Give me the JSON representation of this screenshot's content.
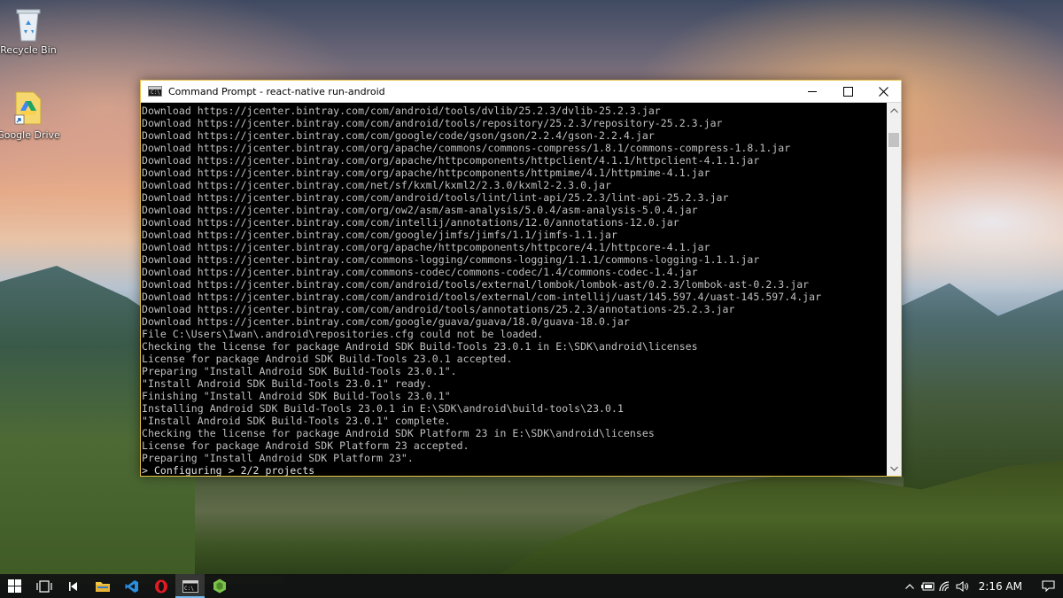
{
  "desktop": {
    "icons": [
      {
        "label": "Recycle Bin",
        "icon": "recycle-bin-icon"
      },
      {
        "label": "Google Drive",
        "icon": "google-drive-icon"
      }
    ]
  },
  "window": {
    "title": "Command Prompt - react-native  run-android",
    "controls": [
      "minimize",
      "maximize",
      "close"
    ],
    "border_color": "#e6c147"
  },
  "console": {
    "lines": [
      "Download https://jcenter.bintray.com/com/android/tools/dvlib/25.2.3/dvlib-25.2.3.jar",
      "Download https://jcenter.bintray.com/com/android/tools/repository/25.2.3/repository-25.2.3.jar",
      "Download https://jcenter.bintray.com/com/google/code/gson/gson/2.2.4/gson-2.2.4.jar",
      "Download https://jcenter.bintray.com/org/apache/commons/commons-compress/1.8.1/commons-compress-1.8.1.jar",
      "Download https://jcenter.bintray.com/org/apache/httpcomponents/httpclient/4.1.1/httpclient-4.1.1.jar",
      "Download https://jcenter.bintray.com/org/apache/httpcomponents/httpmime/4.1/httpmime-4.1.jar",
      "Download https://jcenter.bintray.com/net/sf/kxml/kxml2/2.3.0/kxml2-2.3.0.jar",
      "Download https://jcenter.bintray.com/com/android/tools/lint/lint-api/25.2.3/lint-api-25.2.3.jar",
      "Download https://jcenter.bintray.com/org/ow2/asm/asm-analysis/5.0.4/asm-analysis-5.0.4.jar",
      "Download https://jcenter.bintray.com/com/intellij/annotations/12.0/annotations-12.0.jar",
      "Download https://jcenter.bintray.com/com/google/jimfs/jimfs/1.1/jimfs-1.1.jar",
      "Download https://jcenter.bintray.com/org/apache/httpcomponents/httpcore/4.1/httpcore-4.1.jar",
      "Download https://jcenter.bintray.com/commons-logging/commons-logging/1.1.1/commons-logging-1.1.1.jar",
      "Download https://jcenter.bintray.com/commons-codec/commons-codec/1.4/commons-codec-1.4.jar",
      "Download https://jcenter.bintray.com/com/android/tools/external/lombok/lombok-ast/0.2.3/lombok-ast-0.2.3.jar",
      "Download https://jcenter.bintray.com/com/android/tools/external/com-intellij/uast/145.597.4/uast-145.597.4.jar",
      "Download https://jcenter.bintray.com/com/android/tools/annotations/25.2.3/annotations-25.2.3.jar",
      "Download https://jcenter.bintray.com/com/google/guava/guava/18.0/guava-18.0.jar",
      "File C:\\Users\\Iwan\\.android\\repositories.cfg could not be loaded.",
      "Checking the license for package Android SDK Build-Tools 23.0.1 in E:\\SDK\\android\\licenses",
      "License for package Android SDK Build-Tools 23.0.1 accepted.",
      "Preparing \"Install Android SDK Build-Tools 23.0.1\".",
      "\"Install Android SDK Build-Tools 23.0.1\" ready.",
      "Finishing \"Install Android SDK Build-Tools 23.0.1\"",
      "Installing Android SDK Build-Tools 23.0.1 in E:\\SDK\\android\\build-tools\\23.0.1",
      "\"Install Android SDK Build-Tools 23.0.1\" complete.",
      "Checking the license for package Android SDK Platform 23 in E:\\SDK\\android\\licenses",
      "License for package Android SDK Platform 23 accepted.",
      "Preparing \"Install Android SDK Platform 23\"."
    ],
    "progress_line": "> Configuring > 2/2 projects"
  },
  "taskbar": {
    "apps": [
      {
        "name": "start",
        "icon": "windows-start-icon"
      },
      {
        "name": "task-view",
        "icon": "task-view-icon"
      },
      {
        "name": "media",
        "icon": "media-prev-icon"
      },
      {
        "name": "file-explorer",
        "icon": "folder-icon"
      },
      {
        "name": "vs-code",
        "icon": "vscode-icon"
      },
      {
        "name": "opera",
        "icon": "opera-icon"
      },
      {
        "name": "command-prompt",
        "icon": "cmd-icon",
        "active": true
      },
      {
        "name": "node",
        "icon": "node-icon"
      }
    ],
    "tray": {
      "icons": [
        "chevron-up-icon",
        "battery-icon",
        "wifi-icon",
        "volume-icon"
      ],
      "time": "2:16 AM"
    }
  }
}
